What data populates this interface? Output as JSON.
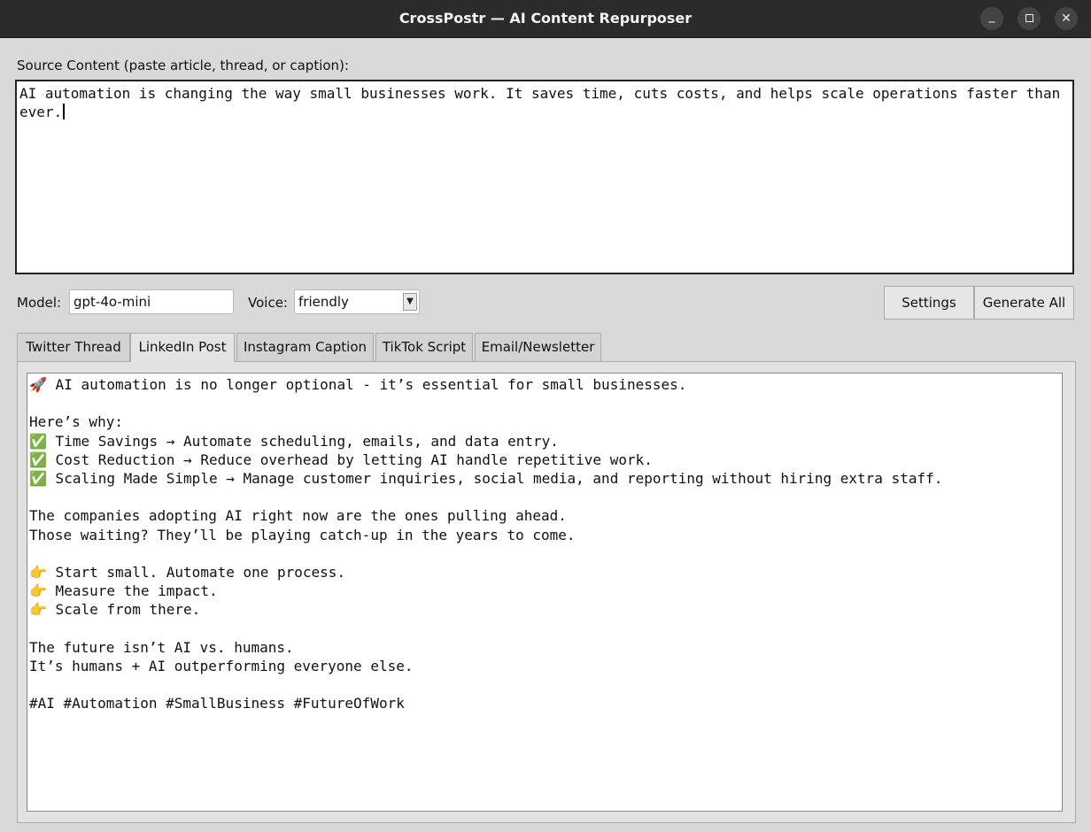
{
  "window": {
    "title": "CrossPostr — AI Content Repurposer",
    "minimize_glyph": "_",
    "close_glyph": "✕"
  },
  "source": {
    "label": "Source Content (paste article, thread, or caption):",
    "text": "AI automation is changing the way small businesses work. It saves time, cuts costs, and helps scale operations faster than ever."
  },
  "controls": {
    "model_label": "Model:",
    "model_value": "gpt-4o-mini",
    "voice_label": "Voice:",
    "voice_value": "friendly",
    "voice_arrow": "▼",
    "settings_label": "Settings",
    "generate_label": "Generate All"
  },
  "tabs": [
    {
      "label": "Twitter Thread",
      "active": false
    },
    {
      "label": "LinkedIn Post",
      "active": true
    },
    {
      "label": "Instagram Caption",
      "active": false
    },
    {
      "label": "TikTok Script",
      "active": false
    },
    {
      "label": "Email/Newsletter",
      "active": false
    }
  ],
  "output": {
    "text": "🚀 AI automation is no longer optional - it’s essential for small businesses.\n\nHere’s why:\n✅ Time Savings → Automate scheduling, emails, and data entry.\n✅ Cost Reduction → Reduce overhead by letting AI handle repetitive work.\n✅ Scaling Made Simple → Manage customer inquiries, social media, and reporting without hiring extra staff.\n\nThe companies adopting AI right now are the ones pulling ahead.\nThose waiting? They’ll be playing catch-up in the years to come.\n\n👉 Start small. Automate one process.\n👉 Measure the impact.\n👉 Scale from there.\n\nThe future isn’t AI vs. humans.\nIt’s humans + AI outperforming everyone else.\n\n#AI #Automation #SmallBusiness #FutureOfWork"
  }
}
